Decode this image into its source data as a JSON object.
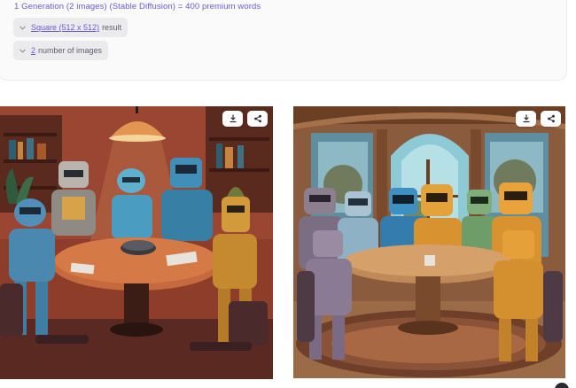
{
  "generation": {
    "summary": "1 Generation (2 images) (Stable Diffusion) = 400 premium words"
  },
  "options": {
    "size_link": "Square (512 x 512)",
    "size_suffix": "result",
    "count_link": "2",
    "count_suffix": "number of images"
  },
  "images": [
    {
      "download_icon": "download-icon",
      "share_icon": "share-icon"
    },
    {
      "download_icon": "download-icon",
      "share_icon": "share-icon"
    }
  ],
  "colors": {
    "accent": "#6a5ad0",
    "chip_bg": "#ebebee",
    "card_bg": "#fafafb"
  }
}
